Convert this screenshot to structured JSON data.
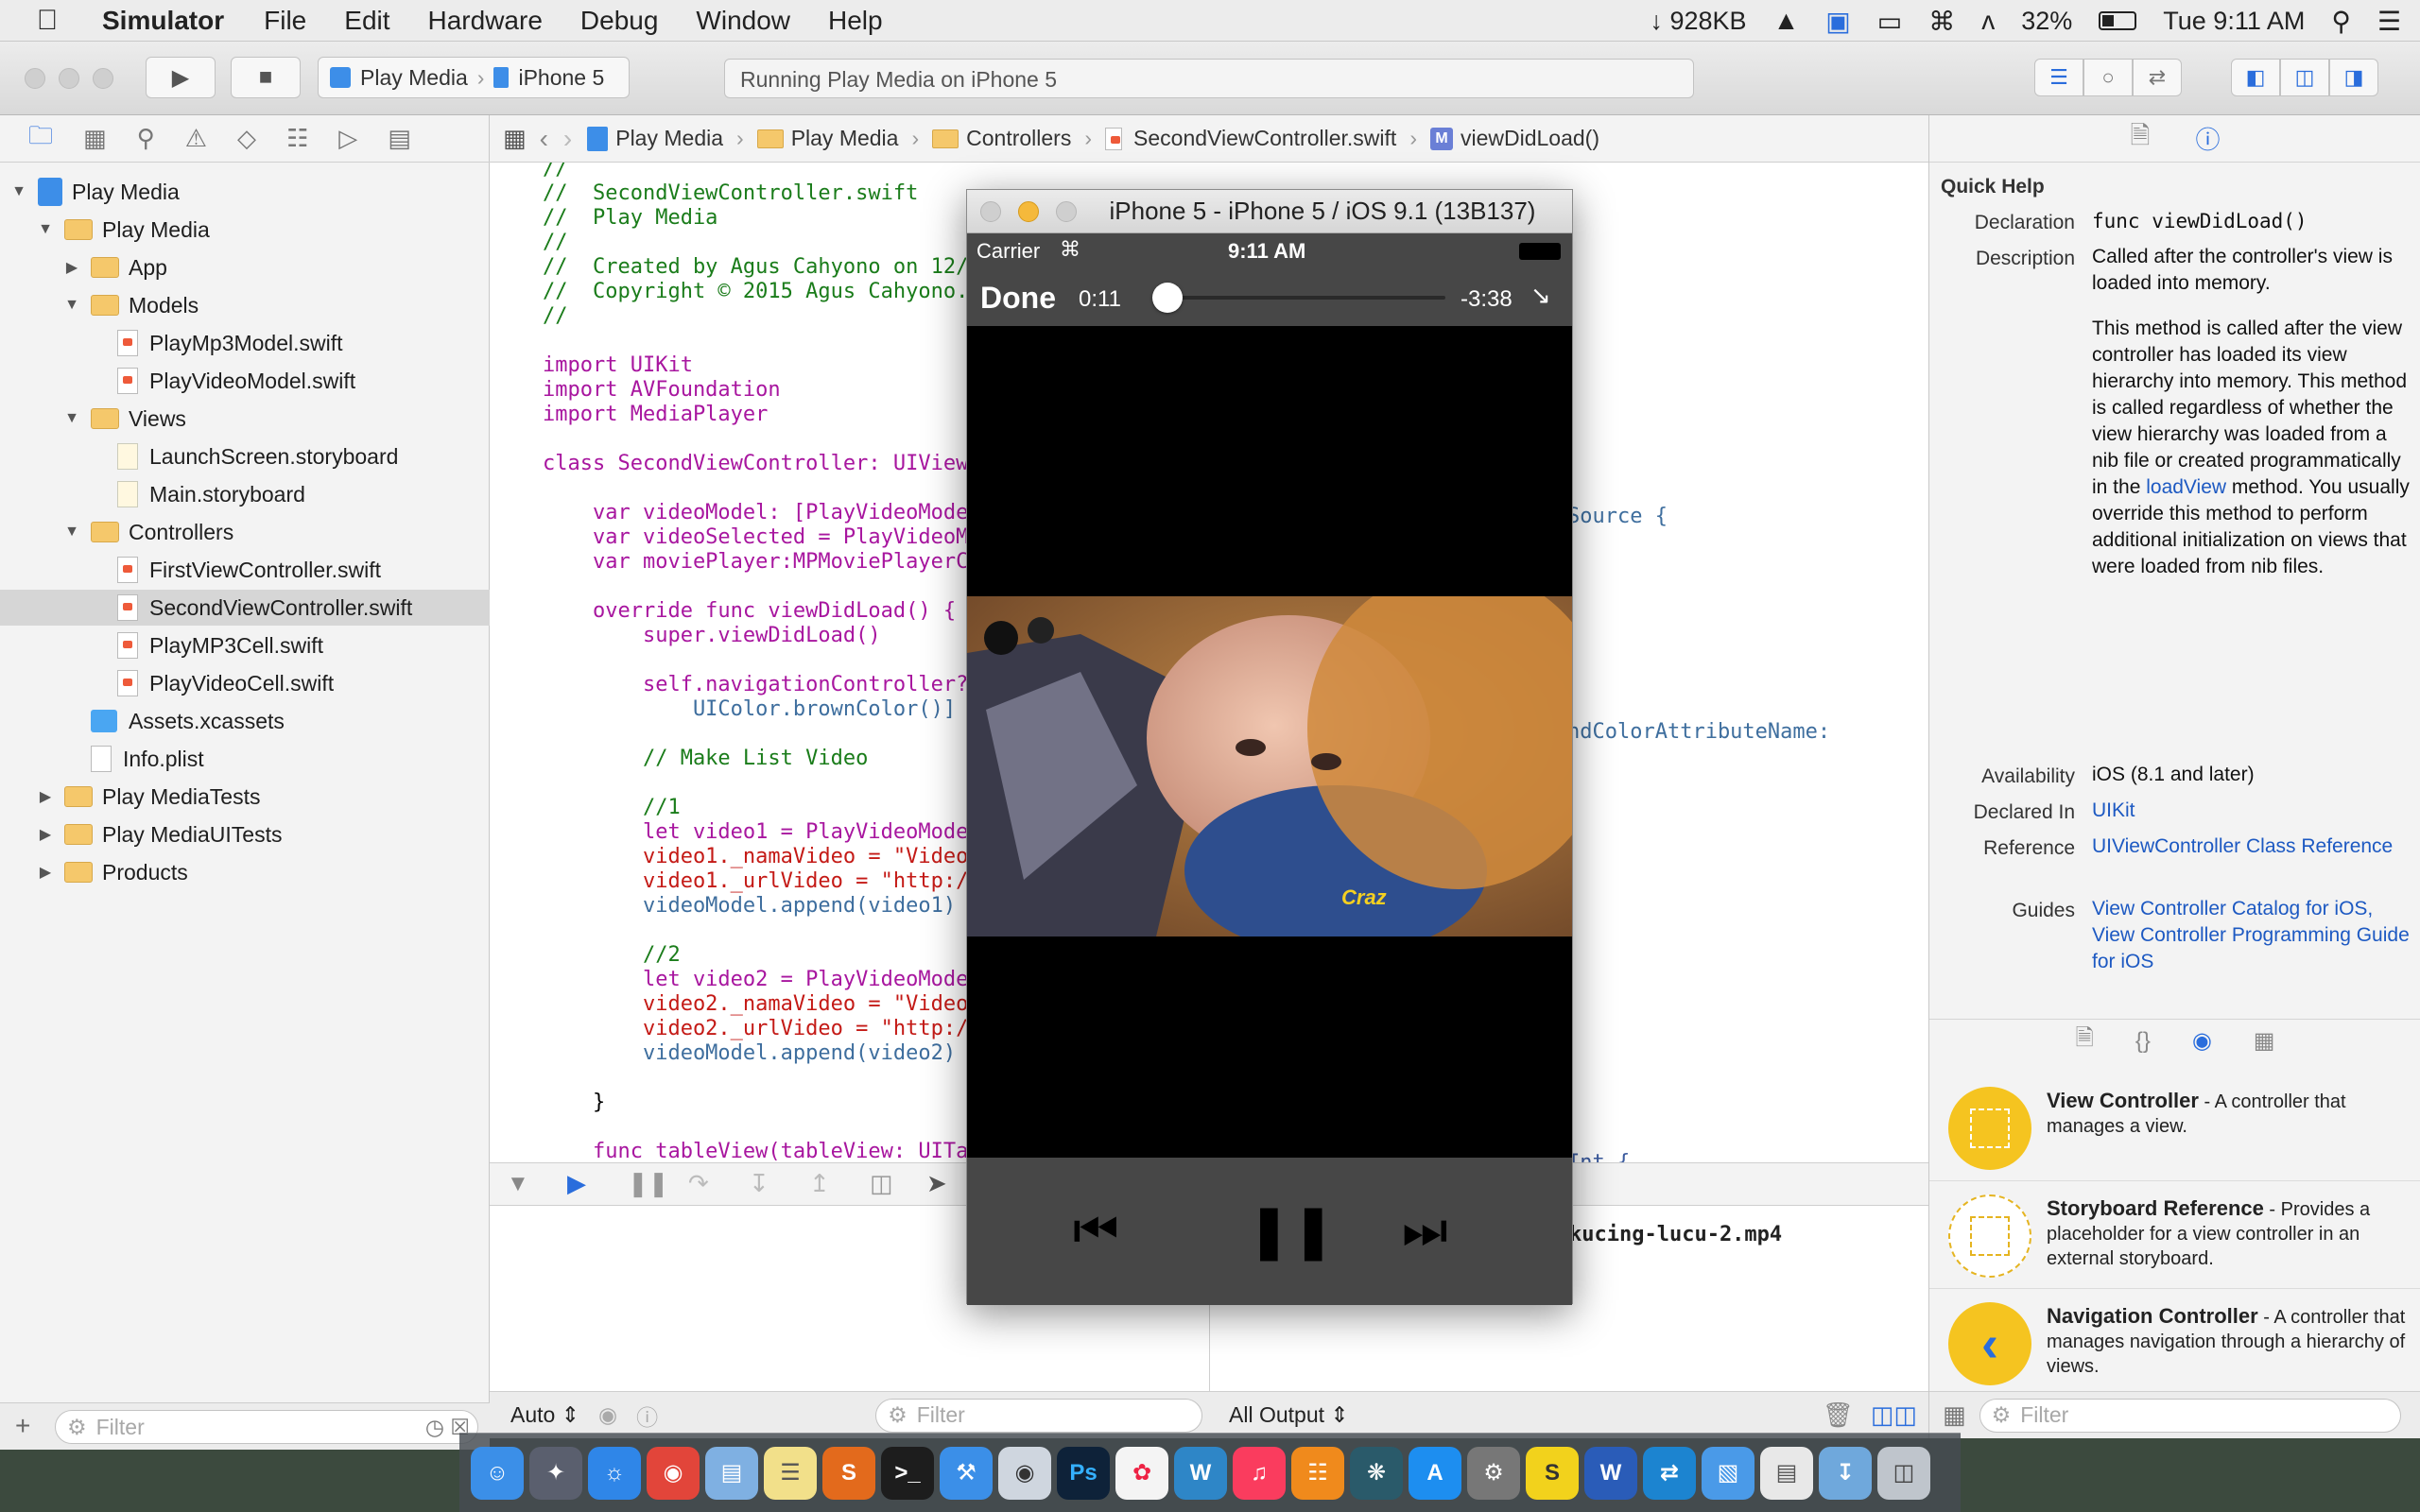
{
  "menubar": {
    "app_name": "Simulator",
    "items": [
      "File",
      "Edit",
      "Hardware",
      "Debug",
      "Window",
      "Help"
    ],
    "net_speed": "↓ 928KB",
    "battery": "32%",
    "clock": "Tue 9:11 AM"
  },
  "toolbar": {
    "scheme_target": "Play Media",
    "scheme_device": "iPhone 5",
    "activity_text": "Running Play Media on iPhone 5"
  },
  "navigator": {
    "rows": [
      {
        "label": "Play Media",
        "kind": "project",
        "depth": 0,
        "open": true
      },
      {
        "label": "Play Media",
        "kind": "folder",
        "depth": 1,
        "open": true
      },
      {
        "label": "App",
        "kind": "folder",
        "depth": 2,
        "open": false
      },
      {
        "label": "Models",
        "kind": "folder",
        "depth": 2,
        "open": true
      },
      {
        "label": "PlayMp3Model.swift",
        "kind": "swift",
        "depth": 3
      },
      {
        "label": "PlayVideoModel.swift",
        "kind": "swift",
        "depth": 3
      },
      {
        "label": "Views",
        "kind": "folder",
        "depth": 2,
        "open": true
      },
      {
        "label": "LaunchScreen.storyboard",
        "kind": "storyboard",
        "depth": 3
      },
      {
        "label": "Main.storyboard",
        "kind": "storyboard",
        "depth": 3
      },
      {
        "label": "Controllers",
        "kind": "folder",
        "depth": 2,
        "open": true
      },
      {
        "label": "FirstViewController.swift",
        "kind": "swift",
        "depth": 3
      },
      {
        "label": "SecondViewController.swift",
        "kind": "swift",
        "depth": 3,
        "selected": true
      },
      {
        "label": "PlayMP3Cell.swift",
        "kind": "swift",
        "depth": 3
      },
      {
        "label": "PlayVideoCell.swift",
        "kind": "swift",
        "depth": 3
      },
      {
        "label": "Assets.xcassets",
        "kind": "assets",
        "depth": 2
      },
      {
        "label": "Info.plist",
        "kind": "plist",
        "depth": 2
      },
      {
        "label": "Play MediaTests",
        "kind": "folder",
        "depth": 1,
        "open": false
      },
      {
        "label": "Play MediaUITests",
        "kind": "folder",
        "depth": 1,
        "open": false
      },
      {
        "label": "Products",
        "kind": "folder",
        "depth": 1,
        "open": false
      }
    ],
    "filter_placeholder": "Filter"
  },
  "jumpbar": {
    "crumbs": [
      "Play Media",
      "Play Media",
      "Controllers",
      "SecondViewController.swift",
      "viewDidLoad()"
    ]
  },
  "editor": {
    "lines": [
      {
        "t": "//",
        "c": "comment"
      },
      {
        "t": "//  SecondViewController.swift",
        "c": "comment"
      },
      {
        "t": "//  Play Media",
        "c": "comment"
      },
      {
        "t": "//",
        "c": "comment"
      },
      {
        "t": "//  Created by Agus Cahyono on 12/",
        "c": "comment"
      },
      {
        "t": "//  Copyright © 2015 Agus Cahyono.",
        "c": "comment"
      },
      {
        "t": "//",
        "c": "comment"
      },
      {
        "t": "",
        "c": "plain"
      },
      {
        "t": "import UIKit",
        "c": "kw"
      },
      {
        "t": "import AVFoundation",
        "c": "kw"
      },
      {
        "t": "import MediaPlayer",
        "c": "kw"
      },
      {
        "t": "",
        "c": "plain"
      },
      {
        "t": "class SecondViewController: UIView",
        "c": "kw"
      },
      {
        "t": "",
        "c": "plain"
      },
      {
        "t": "    var videoModel: [PlayVideoMode",
        "c": "kw"
      },
      {
        "t": "    var videoSelected = PlayVideoM",
        "c": "kw"
      },
      {
        "t": "    var moviePlayer:MPMoviePlayerC",
        "c": "kw"
      },
      {
        "t": "",
        "c": "plain"
      },
      {
        "t": "    override func viewDidLoad() {",
        "c": "kw"
      },
      {
        "t": "        super.viewDidLoad()",
        "c": "kw"
      },
      {
        "t": "",
        "c": "plain"
      },
      {
        "t": "        self.navigationController?",
        "c": "kw"
      },
      {
        "t": "            UIColor.brownColor()]",
        "c": "ident"
      },
      {
        "t": "",
        "c": "plain"
      },
      {
        "t": "        // Make List Video",
        "c": "comment"
      },
      {
        "t": "",
        "c": "plain"
      },
      {
        "t": "        //1",
        "c": "comment"
      },
      {
        "t": "        let video1 = PlayVideoMode",
        "c": "kw"
      },
      {
        "t": "        video1._namaVideo = \"Video",
        "c": "str"
      },
      {
        "t": "        video1._urlVideo = \"http:/",
        "c": "str"
      },
      {
        "t": "        videoModel.append(video1)",
        "c": "ident"
      },
      {
        "t": "",
        "c": "plain"
      },
      {
        "t": "        //2",
        "c": "comment"
      },
      {
        "t": "        let video2 = PlayVideoMode",
        "c": "kw"
      },
      {
        "t": "        video2._namaVideo = \"Video",
        "c": "str"
      },
      {
        "t": "        video2._urlVideo = \"http:/",
        "c": "str"
      },
      {
        "t": "        videoModel.append(video2)",
        "c": "ident"
      },
      {
        "t": "",
        "c": "plain"
      },
      {
        "t": "    }",
        "c": "plain"
      },
      {
        "t": "",
        "c": "plain"
      },
      {
        "t": "    func tableView(tableView: UITa",
        "c": "kw"
      }
    ],
    "right_fragments": {
      "line12": "Source {",
      "line21": "ndColorAttributeName:",
      "line40": "Int {"
    }
  },
  "debug": {
    "console_text": "kucing-lucu-2.mp4",
    "vars_mode": "Auto",
    "console_mode": "All Output",
    "filter_placeholder": "Filter"
  },
  "inspector": {
    "title": "Quick Help",
    "declaration_key": "Declaration",
    "declaration": "func viewDidLoad()",
    "description_key": "Description",
    "description_1": "Called after the controller's view is loaded into memory.",
    "description_2a": "This method is called after the view controller has loaded its view hierarchy into memory. This method is called regardless of whether the view hierarchy was loaded from a nib file or created programmatically in the ",
    "description_2_link": "loadView",
    "description_2b": " method. You usually override this method to perform additional initialization on views that were loaded from nib files.",
    "availability_key": "Availability",
    "availability": "iOS (8.1 and later)",
    "declared_in_key": "Declared In",
    "declared_in": "UIKit",
    "reference_key": "Reference",
    "reference": "UIViewController Class Reference",
    "guides_key": "Guides",
    "guides_1": "View Controller Catalog for iOS",
    "guides_2": ", View Controller Programming Guide for iOS",
    "library": [
      {
        "name": "View Controller",
        "desc": " - A controller that manages a view."
      },
      {
        "name": "Storyboard Reference",
        "desc": " - Provides a placeholder for a view controller in an external storyboard."
      },
      {
        "name": "Navigation Controller",
        "desc": " - A controller that manages navigation through a hierarchy of views."
      }
    ],
    "filter_placeholder": "Filter"
  },
  "simulator": {
    "title": "iPhone 5 - iPhone 5 / iOS 9.1 (13B137)",
    "carrier": "Carrier",
    "time": "9:11 AM",
    "done_label": "Done",
    "elapsed": "0:11",
    "remaining": "-3:38",
    "progress": 0.05,
    "video_caption": "Craz"
  },
  "colors": {
    "accent": "#2a6ddc",
    "folder": "#f5c86b",
    "simulator_bar": "#474747",
    "library_yellow": "#f5c420"
  }
}
